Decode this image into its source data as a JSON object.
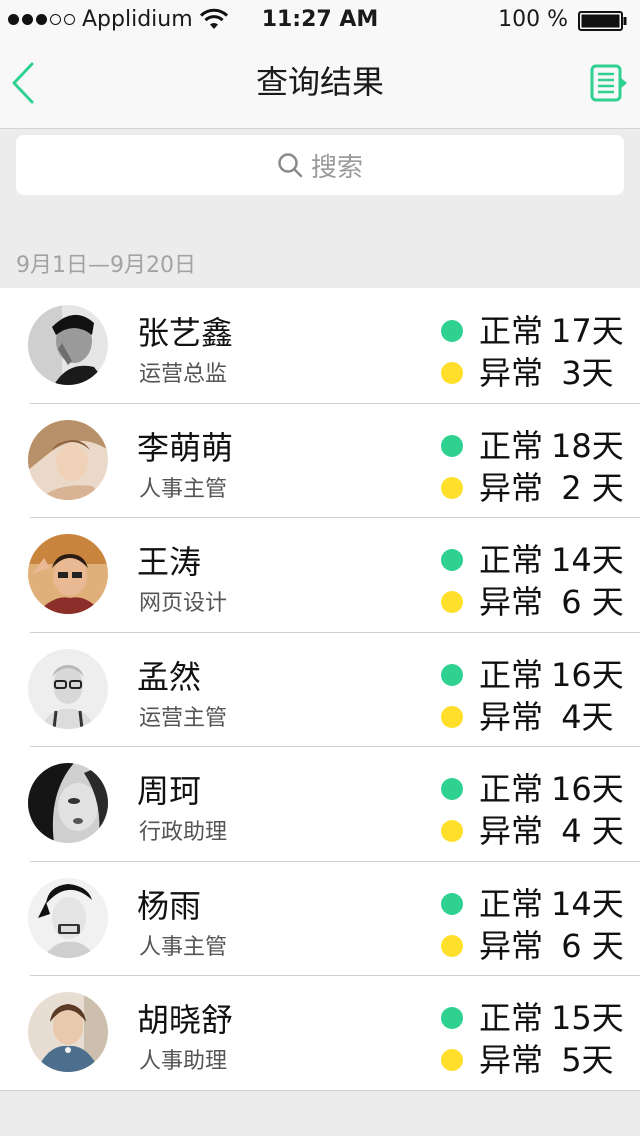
{
  "status_bar": {
    "carrier": "Applidium",
    "time": "11:27 AM",
    "battery": "100 %"
  },
  "nav": {
    "title": "查询结果"
  },
  "search": {
    "placeholder": "搜索"
  },
  "date_range": "9月1日—9月20日",
  "colors": {
    "accent": "#2ed18f",
    "normal_dot": "#2ed18f",
    "abnormal_dot": "#ffdf2a"
  },
  "stat_labels": {
    "normal": "正常",
    "abnormal": "异常"
  },
  "people": [
    {
      "name": "张艺鑫",
      "role": "运营总监",
      "normal": "17天",
      "abnormal": " 3天"
    },
    {
      "name": "李萌萌",
      "role": "人事主管",
      "normal": "18天",
      "abnormal": " 2 天"
    },
    {
      "name": "王涛",
      "role": "网页设计",
      "normal": "14天",
      "abnormal": " 6 天"
    },
    {
      "name": "孟然",
      "role": "运营主管",
      "normal": "16天",
      "abnormal": " 4天"
    },
    {
      "name": "周珂",
      "role": "行政助理",
      "normal": "16天",
      "abnormal": " 4 天"
    },
    {
      "name": "杨雨",
      "role": "人事主管",
      "normal": "14天",
      "abnormal": " 6 天"
    },
    {
      "name": "胡晓舒",
      "role": "人事助理",
      "normal": "15天",
      "abnormal": " 5天"
    }
  ]
}
